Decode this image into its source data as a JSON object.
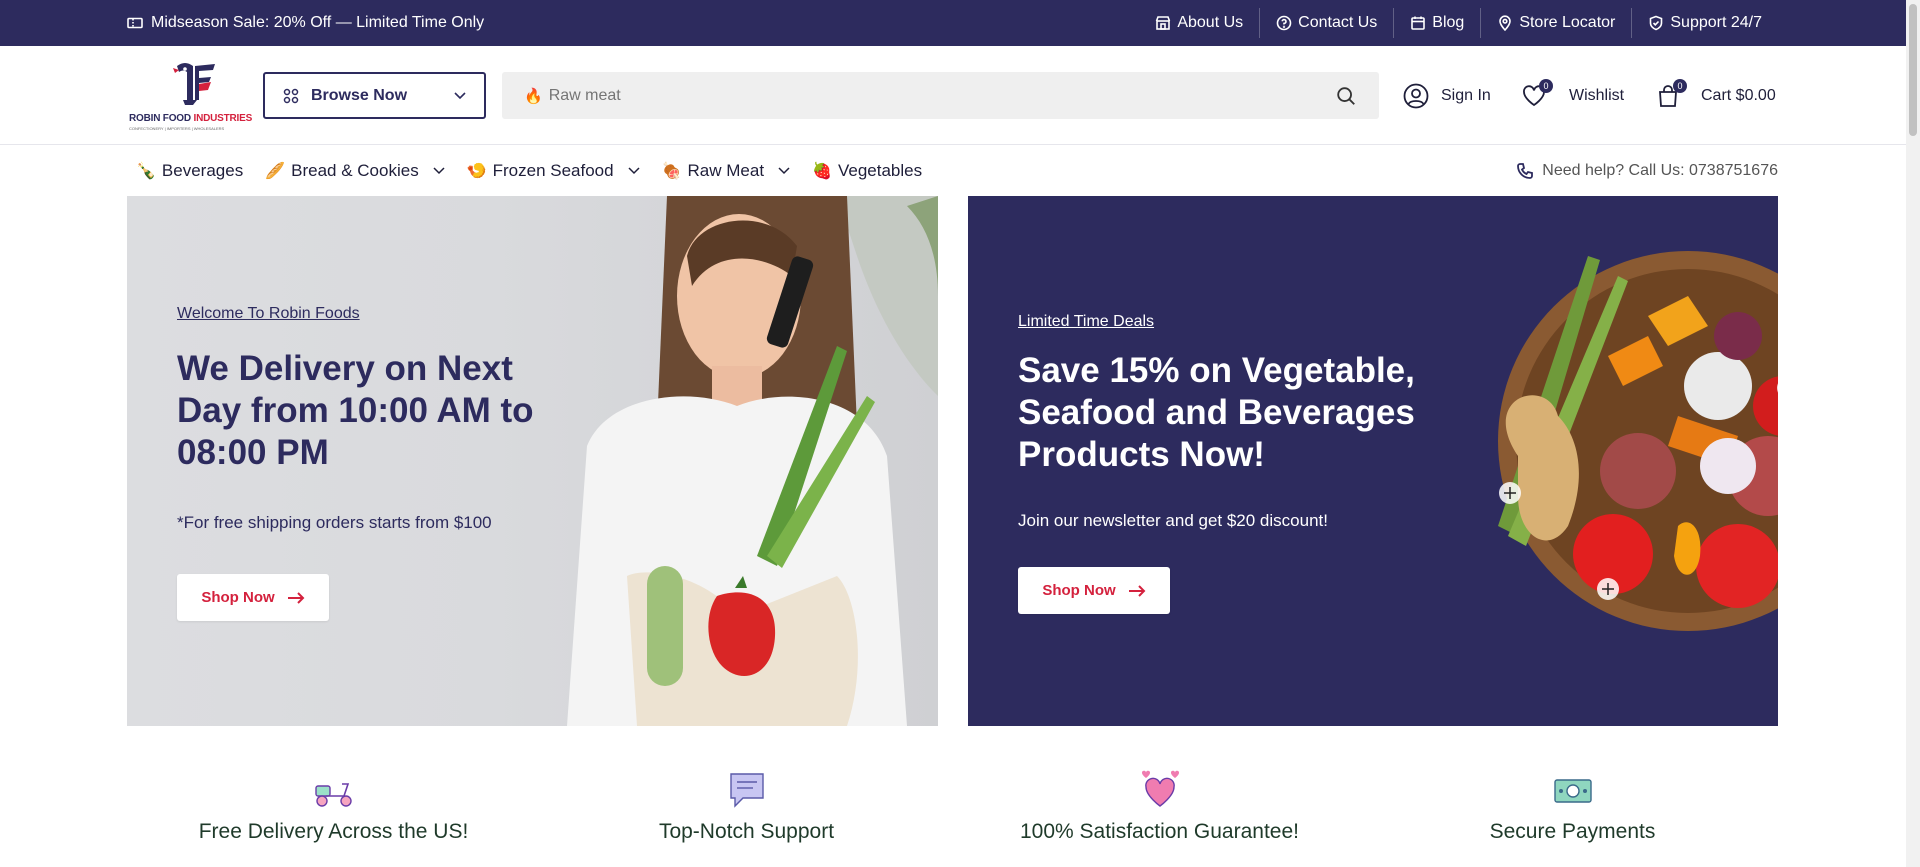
{
  "topbar": {
    "promo": "Midseason Sale: 20% Off — Limited Time Only",
    "links": [
      {
        "label": "About Us",
        "icon": "store-icon"
      },
      {
        "label": "Contact Us",
        "icon": "help-circle-icon"
      },
      {
        "label": "Blog",
        "icon": "calendar-icon"
      },
      {
        "label": "Store Locator",
        "icon": "map-pin-icon"
      },
      {
        "label": "Support 24/7",
        "icon": "shield-check-icon"
      }
    ]
  },
  "brand": {
    "name_part1": "ROBIN FOOD",
    "name_part2": "INDUSTRIES",
    "tagline": "CONFECTIONERY | IMPORTERS | WHOLESALERS",
    "primary_color": "#2d2b5e",
    "accent_color": "#d4213d"
  },
  "header": {
    "browse_label": "Browse Now",
    "search_placeholder": "Raw meat",
    "sign_in": "Sign In",
    "wishlist": "Wishlist",
    "wishlist_count": "0",
    "cart": "Cart $0.00",
    "cart_count": "0"
  },
  "categories": [
    {
      "label": "Beverages",
      "emoji": "🍾",
      "dropdown": false
    },
    {
      "label": "Bread & Cookies",
      "emoji": "🥖",
      "dropdown": true
    },
    {
      "label": "Frozen Seafood",
      "emoji": "🍤",
      "dropdown": true
    },
    {
      "label": "Raw Meat",
      "emoji": "🍖",
      "dropdown": true
    },
    {
      "label": "Vegetables",
      "emoji": "🍓",
      "dropdown": false
    }
  ],
  "help": {
    "label": "Need help? Call Us: 0738751676"
  },
  "hero_left": {
    "eyebrow": "Welcome To Robin Foods",
    "headline": "We Delivery on Next Day from 10:00 AM to 08:00 PM",
    "subtext": "*For free shipping orders starts from $100",
    "button": "Shop Now"
  },
  "hero_right": {
    "eyebrow": "Limited Time Deals",
    "headline": "Save 15% on Vegetable, Seafood and Beverages Products Now!",
    "subtext": "Join our newsletter and get $20 discount!",
    "button": "Shop Now"
  },
  "features": [
    {
      "title": "Free Delivery Across the US!",
      "icon": "scooter-icon"
    },
    {
      "title": "Top-Notch Support",
      "icon": "chat-icon"
    },
    {
      "title": "100% Satisfaction Guarantee!",
      "icon": "hearts-icon"
    },
    {
      "title": "Secure Payments",
      "icon": "cash-icon"
    }
  ]
}
